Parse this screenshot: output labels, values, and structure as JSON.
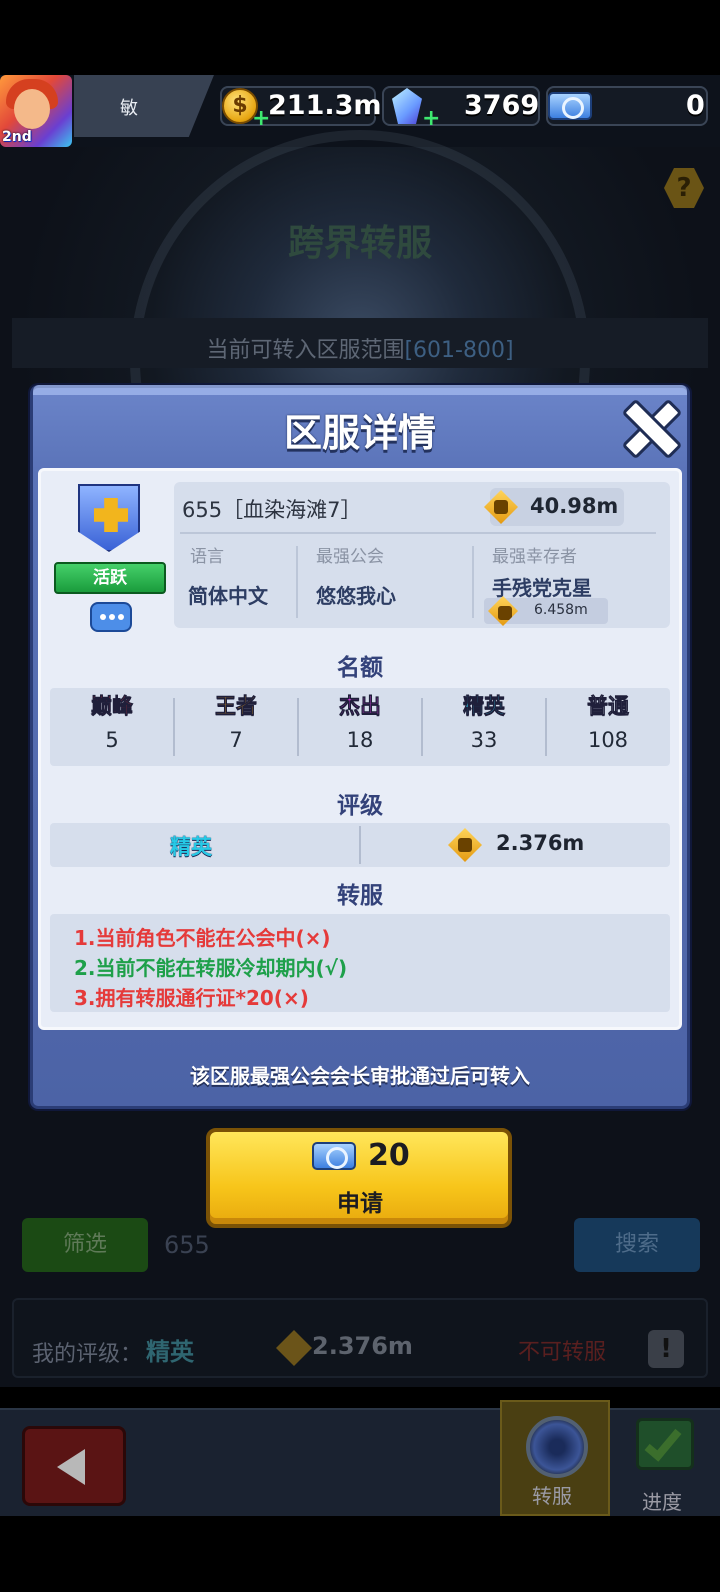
{
  "topbar": {
    "avatar_badge": "2nd",
    "player_name": "敏",
    "gold": "211.3m",
    "gems": "3769",
    "tickets": "0"
  },
  "background": {
    "title": "跨界转服",
    "range_label": "当前可转入区服范围",
    "range_value": "[601-800]",
    "filter_label": "筛选",
    "search_value": "655",
    "search_label": "搜索",
    "my_rating_label": "我的评级：",
    "my_rating_value": "精英",
    "my_power": "2.376m",
    "transfer_status": "不可转服"
  },
  "modal": {
    "title": "区服详情",
    "server_name": "655［血染海滩7］",
    "server_power": "40.98m",
    "status_badge": "活跃",
    "columns": [
      {
        "label": "语言",
        "value": "简体中文"
      },
      {
        "label": "最强公会",
        "value": "悠悠我心"
      },
      {
        "label": "最强幸存者",
        "value": "手残党克星"
      }
    ],
    "survivor_power": "6.458m",
    "quota_title": "名额",
    "quota": [
      {
        "label": "巅峰",
        "value": "5",
        "color": "#ff3c3c"
      },
      {
        "label": "王者",
        "value": "7",
        "color": "#ffb21e"
      },
      {
        "label": "杰出",
        "value": "18",
        "color": "#e23de8"
      },
      {
        "label": "精英",
        "value": "33",
        "color": "#2dc6e8"
      },
      {
        "label": "普通",
        "value": "108",
        "color": "#e7ecf2"
      }
    ],
    "grade_title": "评级",
    "grade_value": "精英",
    "grade_power": "2.376m",
    "transfer_title": "转服",
    "requirements": [
      {
        "text": "1.当前角色不能在公会中(×)",
        "color": "#e53a3a"
      },
      {
        "text": "2.当前不能在转服冷却期内(√)",
        "color": "#1ea04a"
      },
      {
        "text": "3.拥有转服通行证*20(×)",
        "color": "#e53a3a"
      }
    ],
    "footer_text": "该区服最强公会会长审批通过后可转入",
    "apply_cost": "20",
    "apply_label": "申请"
  },
  "bottom_nav": {
    "transfer_tab": "转服",
    "progress_tab": "进度"
  }
}
